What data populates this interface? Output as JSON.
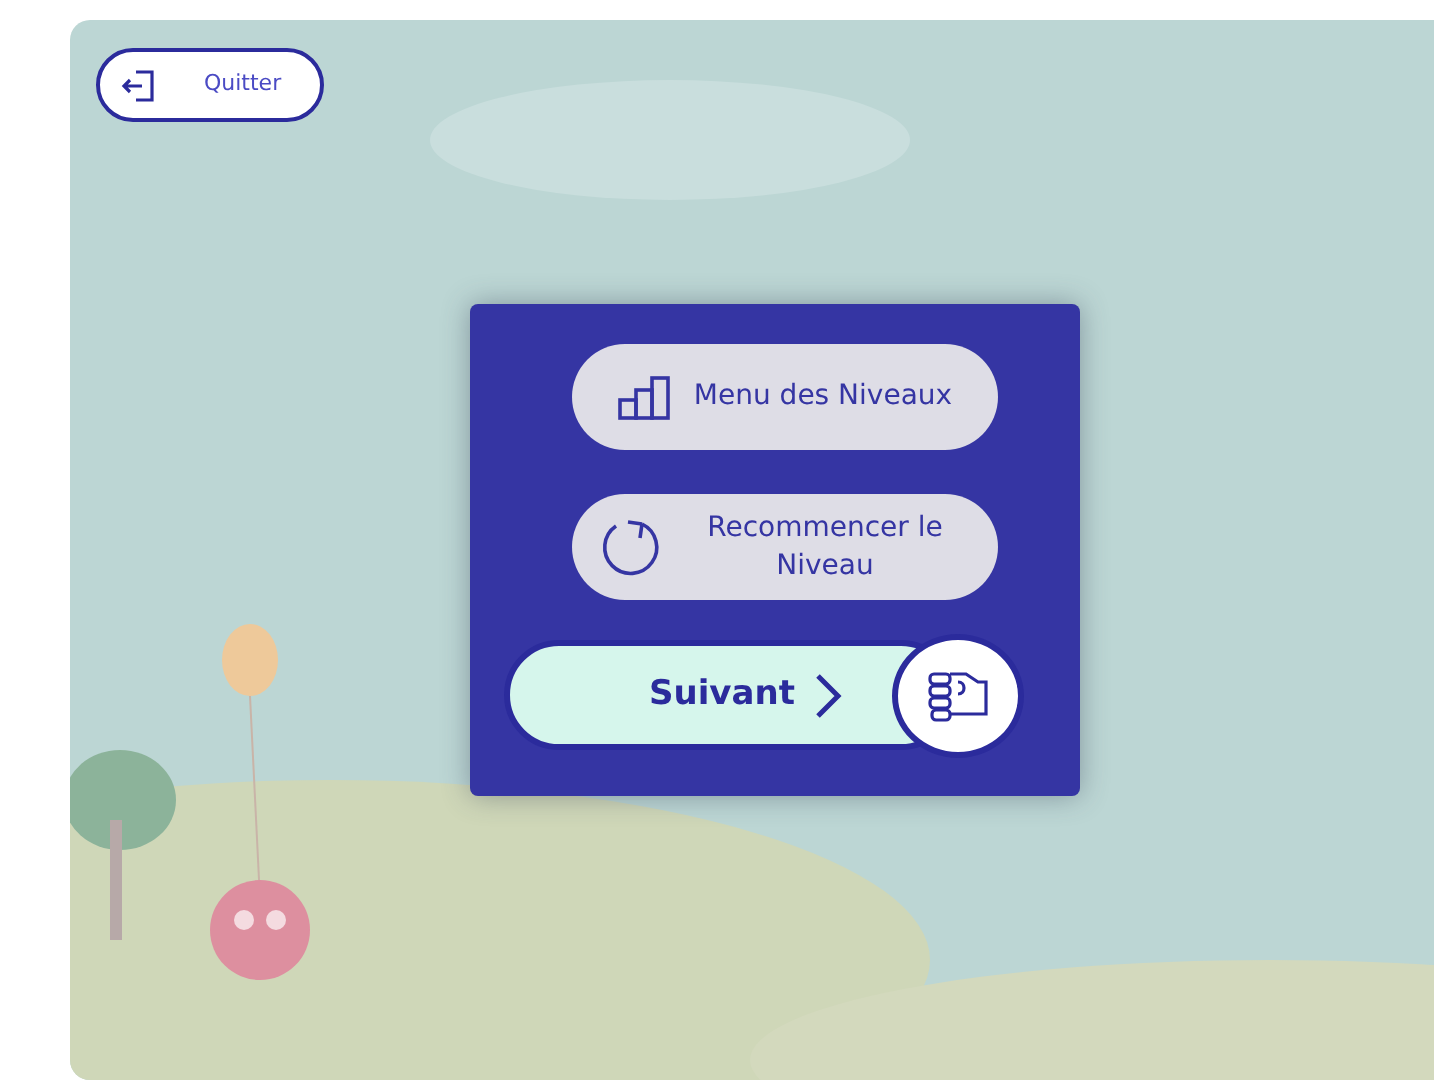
{
  "quit_button": {
    "label": "Quitter"
  },
  "dialog": {
    "buttons": [
      {
        "kind": "levels",
        "label": "Menu des Niveaux"
      },
      {
        "kind": "restart",
        "label": "Recommencer le Niveau"
      },
      {
        "kind": "next",
        "label": "Suivant"
      }
    ]
  }
}
